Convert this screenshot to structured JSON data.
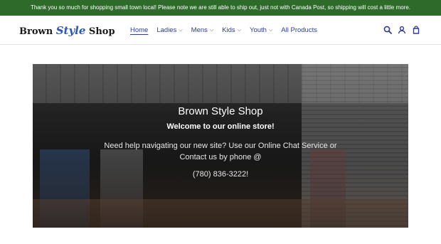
{
  "announcement": "Thank you so much for shopping small town local! Please note we are still able to ship out, just not with Canada Post, so shipping will cost a little more.",
  "logo": {
    "part1": "Brown ",
    "part2": "Style",
    "part3": " Shop"
  },
  "nav": {
    "items": [
      {
        "label": "Home",
        "active": true,
        "dropdown": false
      },
      {
        "label": "Ladies",
        "active": false,
        "dropdown": true
      },
      {
        "label": "Mens",
        "active": false,
        "dropdown": true
      },
      {
        "label": "Kids",
        "active": false,
        "dropdown": true
      },
      {
        "label": "Youth",
        "active": false,
        "dropdown": true
      },
      {
        "label": "All Products",
        "active": false,
        "dropdown": false
      }
    ]
  },
  "header_icons": [
    "search-icon",
    "account-icon",
    "cart-icon"
  ],
  "hero": {
    "title": "Brown Style Shop",
    "subtitle": "Welcome to our online store!",
    "body": "Need help navigating our new site? Use our Online Chat Service or Contact us by phone @",
    "phone": "(780) 836-3222!"
  },
  "colors": {
    "announcement_bg": "#2e6b2b",
    "nav_link": "#2d3aa0",
    "logo_script": "#2d56b8"
  }
}
